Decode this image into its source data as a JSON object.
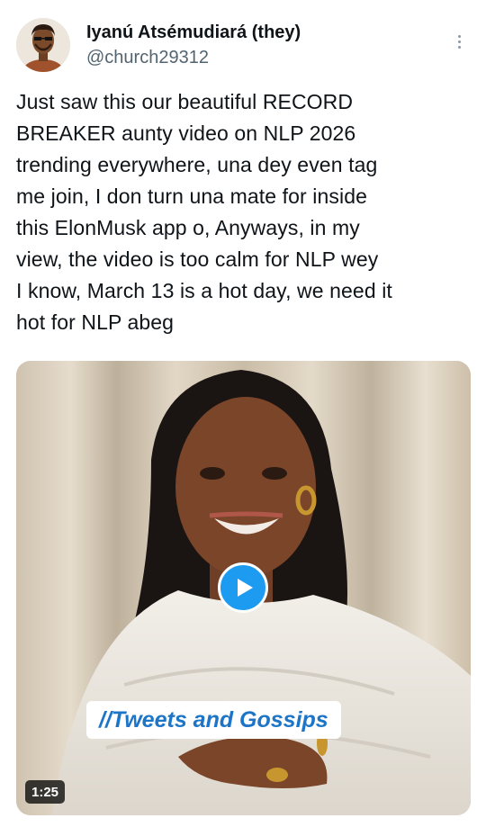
{
  "author": {
    "name": "Iyanú Atsémudiará (they)",
    "handle": "@church29312",
    "avatar_icon": "user-avatar-illustration"
  },
  "more_icon": "more-options-vertical-icon",
  "tweet": {
    "text": "Just saw this our beautiful RECORD\nBREAKER aunty video on NLP 2026\ntrending everywhere, una dey even tag\nme join, I don turn una mate for inside\nthis ElonMusk app o, Anyways, in my\nview, the video is too calm for NLP wey\nI know, March 13 is a hot day, we need it\nhot for NLP abeg"
  },
  "media": {
    "type": "video",
    "caption": "//Tweets and Gossips",
    "duration": "1:25",
    "play_icon": "play-icon"
  },
  "colors": {
    "accent": "#1d9bf0",
    "caption_text": "#1d75c8",
    "handle": "#536471"
  }
}
